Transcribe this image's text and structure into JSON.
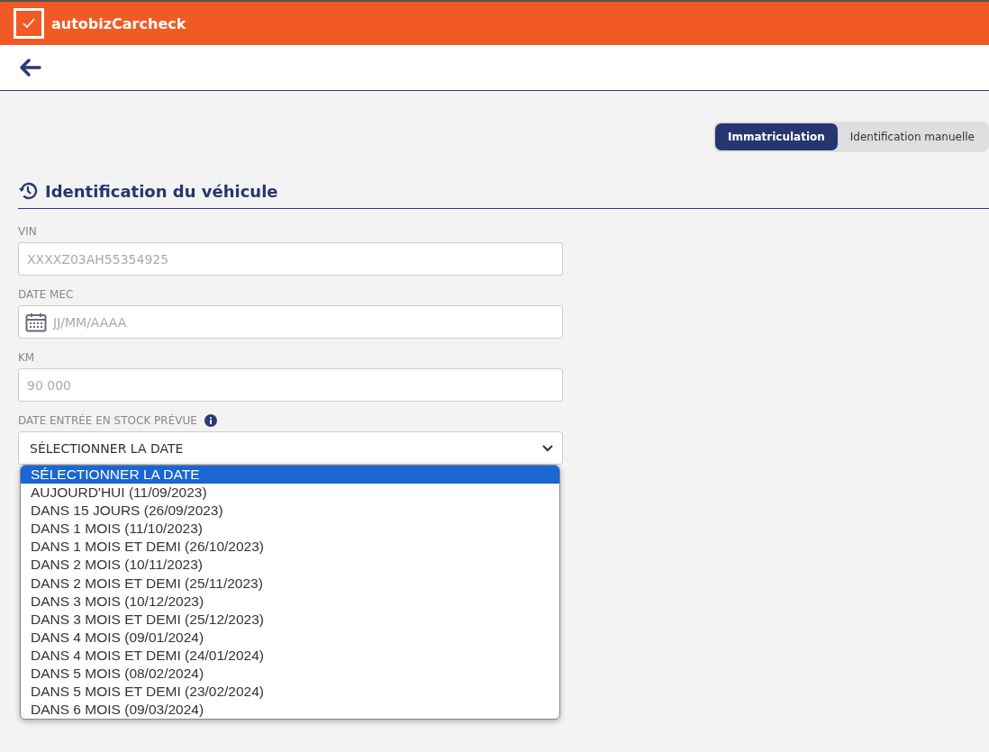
{
  "header": {
    "brand": "autobizCarcheck"
  },
  "mode_toggle": [
    {
      "label": "Immatriculation",
      "selected": true
    },
    {
      "label": "Identification manuelle",
      "selected": false
    }
  ],
  "section": {
    "title": "Identification du véhicule"
  },
  "fields": [
    {
      "label": "VIN",
      "placeholder": "XXXXZ03AH55354925",
      "kind": "text"
    },
    {
      "label": "DATE MEC",
      "placeholder": "JJ/MM/AAAA",
      "kind": "date"
    },
    {
      "label": "KM",
      "placeholder": "90 000",
      "kind": "text"
    }
  ],
  "stock_date": {
    "label": "DATE ENTRÉE EN STOCK PRÉVUE",
    "value": "SÉLECTIONNER LA DATE",
    "options": [
      {
        "label": "SÉLECTIONNER LA DATE",
        "selected": true
      },
      {
        "label": "AUJOURD'HUI (11/09/2023)",
        "selected": false
      },
      {
        "label": "DANS 15 JOURS (26/09/2023)",
        "selected": false
      },
      {
        "label": "DANS 1 MOIS (11/10/2023)",
        "selected": false
      },
      {
        "label": "DANS 1 MOIS ET DEMI (26/10/2023)",
        "selected": false
      },
      {
        "label": "DANS 2 MOIS (10/11/2023)",
        "selected": false
      },
      {
        "label": "DANS 2 MOIS ET DEMI (25/11/2023)",
        "selected": false
      },
      {
        "label": "DANS 3 MOIS (10/12/2023)",
        "selected": false
      },
      {
        "label": "DANS 3 MOIS ET DEMI (25/12/2023)",
        "selected": false
      },
      {
        "label": "DANS 4 MOIS (09/01/2024)",
        "selected": false
      },
      {
        "label": "DANS 4 MOIS ET DEMI (24/01/2024)",
        "selected": false
      },
      {
        "label": "DANS 5 MOIS (08/02/2024)",
        "selected": false
      },
      {
        "label": "DANS 5 MOIS ET DEMI (23/02/2024)",
        "selected": false
      },
      {
        "label": "DANS 6 MOIS (09/03/2024)",
        "selected": false
      }
    ]
  }
}
